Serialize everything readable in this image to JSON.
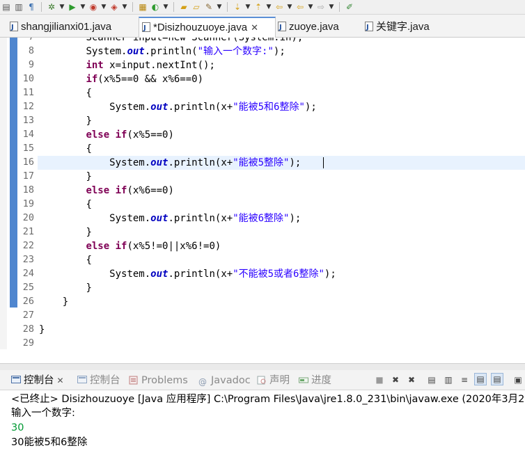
{
  "toolbar": {
    "icons": [
      "debug-icon",
      "run-icon",
      "coverage-icon",
      "external-tools-icon",
      "new-class-icon",
      "new-package-icon",
      "open-type-icon",
      "open-task-icon",
      "search-icon",
      "next-annotation-icon",
      "prev-annotation-icon",
      "back-icon",
      "forward-icon",
      "pin-editor-icon"
    ]
  },
  "editor_tabs": [
    {
      "label": "shangjilianxi01.java",
      "active": false
    },
    {
      "label": "*Disizhouzuoye.java",
      "active": true,
      "close": "✕"
    },
    {
      "label": "zuoye.java",
      "active": false
    },
    {
      "label": "关键字.java",
      "active": false
    }
  ],
  "editor": {
    "line_numbers": [
      "7",
      "8",
      "9",
      "10",
      "11",
      "12",
      "13",
      "14",
      "15",
      "16",
      "17",
      "18",
      "19",
      "20",
      "21",
      "22",
      "23",
      "24",
      "25",
      "26",
      "27",
      "28",
      "29"
    ],
    "lines": [
      {
        "indent": "        ",
        "segments": [
          [
            "plain",
            "Scanner input=new Scanner(System.in);"
          ]
        ]
      },
      {
        "indent": "        ",
        "segments": [
          [
            "plain",
            "System."
          ],
          [
            "fld",
            "out"
          ],
          [
            "plain",
            ".println("
          ],
          [
            "str",
            "\"输入一个数字:\""
          ],
          [
            "plain",
            ");"
          ]
        ]
      },
      {
        "indent": "        ",
        "segments": [
          [
            "kw",
            "int"
          ],
          [
            "plain",
            " x=input.nextInt();"
          ]
        ]
      },
      {
        "indent": "        ",
        "segments": [
          [
            "kw",
            "if"
          ],
          [
            "plain",
            "(x%5==0 && x%6==0)"
          ]
        ]
      },
      {
        "indent": "        ",
        "segments": [
          [
            "plain",
            "{"
          ]
        ]
      },
      {
        "indent": "            ",
        "segments": [
          [
            "plain",
            "System."
          ],
          [
            "fld",
            "out"
          ],
          [
            "plain",
            ".println(x+"
          ],
          [
            "str",
            "\"能被5和6整除\""
          ],
          [
            "plain",
            ");"
          ]
        ]
      },
      {
        "indent": "        ",
        "segments": [
          [
            "plain",
            "}"
          ]
        ]
      },
      {
        "indent": "        ",
        "segments": [
          [
            "kw",
            "else"
          ],
          [
            "plain",
            " "
          ],
          [
            "kw",
            "if"
          ],
          [
            "plain",
            "(x%5==0)"
          ]
        ]
      },
      {
        "indent": "        ",
        "segments": [
          [
            "plain",
            "{"
          ]
        ]
      },
      {
        "indent": "            ",
        "segments": [
          [
            "plain",
            "System."
          ],
          [
            "fld",
            "out"
          ],
          [
            "plain",
            ".println(x+"
          ],
          [
            "str",
            "\"能被5整除\""
          ],
          [
            "plain",
            ");"
          ]
        ]
      },
      {
        "indent": "        ",
        "segments": [
          [
            "plain",
            "}"
          ]
        ]
      },
      {
        "indent": "        ",
        "segments": [
          [
            "kw",
            "else"
          ],
          [
            "plain",
            " "
          ],
          [
            "kw",
            "if"
          ],
          [
            "plain",
            "(x%6==0)"
          ]
        ]
      },
      {
        "indent": "        ",
        "segments": [
          [
            "plain",
            "{"
          ]
        ]
      },
      {
        "indent": "            ",
        "segments": [
          [
            "plain",
            "System."
          ],
          [
            "fld",
            "out"
          ],
          [
            "plain",
            ".println(x+"
          ],
          [
            "str",
            "\"能被6整除\""
          ],
          [
            "plain",
            ");"
          ]
        ]
      },
      {
        "indent": "        ",
        "segments": [
          [
            "plain",
            "}"
          ]
        ]
      },
      {
        "indent": "        ",
        "segments": [
          [
            "kw",
            "else"
          ],
          [
            "plain",
            " "
          ],
          [
            "kw",
            "if"
          ],
          [
            "plain",
            "(x%5!=0||x%6!=0)"
          ]
        ]
      },
      {
        "indent": "        ",
        "segments": [
          [
            "plain",
            "{"
          ]
        ]
      },
      {
        "indent": "            ",
        "segments": [
          [
            "plain",
            "System."
          ],
          [
            "fld",
            "out"
          ],
          [
            "plain",
            ".println(x+"
          ],
          [
            "str",
            "\"不能被5或者6整除\""
          ],
          [
            "plain",
            ");"
          ]
        ]
      },
      {
        "indent": "        ",
        "segments": [
          [
            "plain",
            "}"
          ]
        ]
      },
      {
        "indent": "    ",
        "segments": [
          [
            "plain",
            "}"
          ]
        ]
      },
      {
        "indent": "",
        "segments": []
      },
      {
        "indent": "",
        "segments": [
          [
            "plain",
            "}"
          ]
        ]
      },
      {
        "indent": "",
        "segments": []
      }
    ],
    "current_line": "16"
  },
  "console_panel": {
    "tabs": [
      {
        "label": "控制台",
        "icon": "console-icon",
        "active": true,
        "close": "✕"
      },
      {
        "label": "控制台",
        "icon": "console-icon",
        "active": false
      },
      {
        "label": "Problems",
        "icon": "problems-icon",
        "active": false
      },
      {
        "label": "Javadoc",
        "icon": "javadoc-icon",
        "active": false
      },
      {
        "label": "声明",
        "icon": "declaration-icon",
        "active": false
      },
      {
        "label": "进度",
        "icon": "progress-icon",
        "active": false
      }
    ],
    "buttons": [
      "terminate-icon",
      "remove-launch-icon",
      "remove-all-icon",
      "clear-console-icon",
      "scroll-lock-icon",
      "word-wrap-icon",
      "show-stdout-icon",
      "show-stderr-icon",
      "open-console-icon"
    ],
    "header": "<已终止> Disizhouzuoye [Java 应用程序] C:\\Program Files\\Java\\jre1.8.0_231\\bin\\javaw.exe  (2020年3月2",
    "output": [
      {
        "text": "输入一个数字:",
        "color": "#000000"
      },
      {
        "text": "30",
        "color": "#009933"
      },
      {
        "text": "30能被5和6整除",
        "color": "#000000"
      }
    ]
  }
}
